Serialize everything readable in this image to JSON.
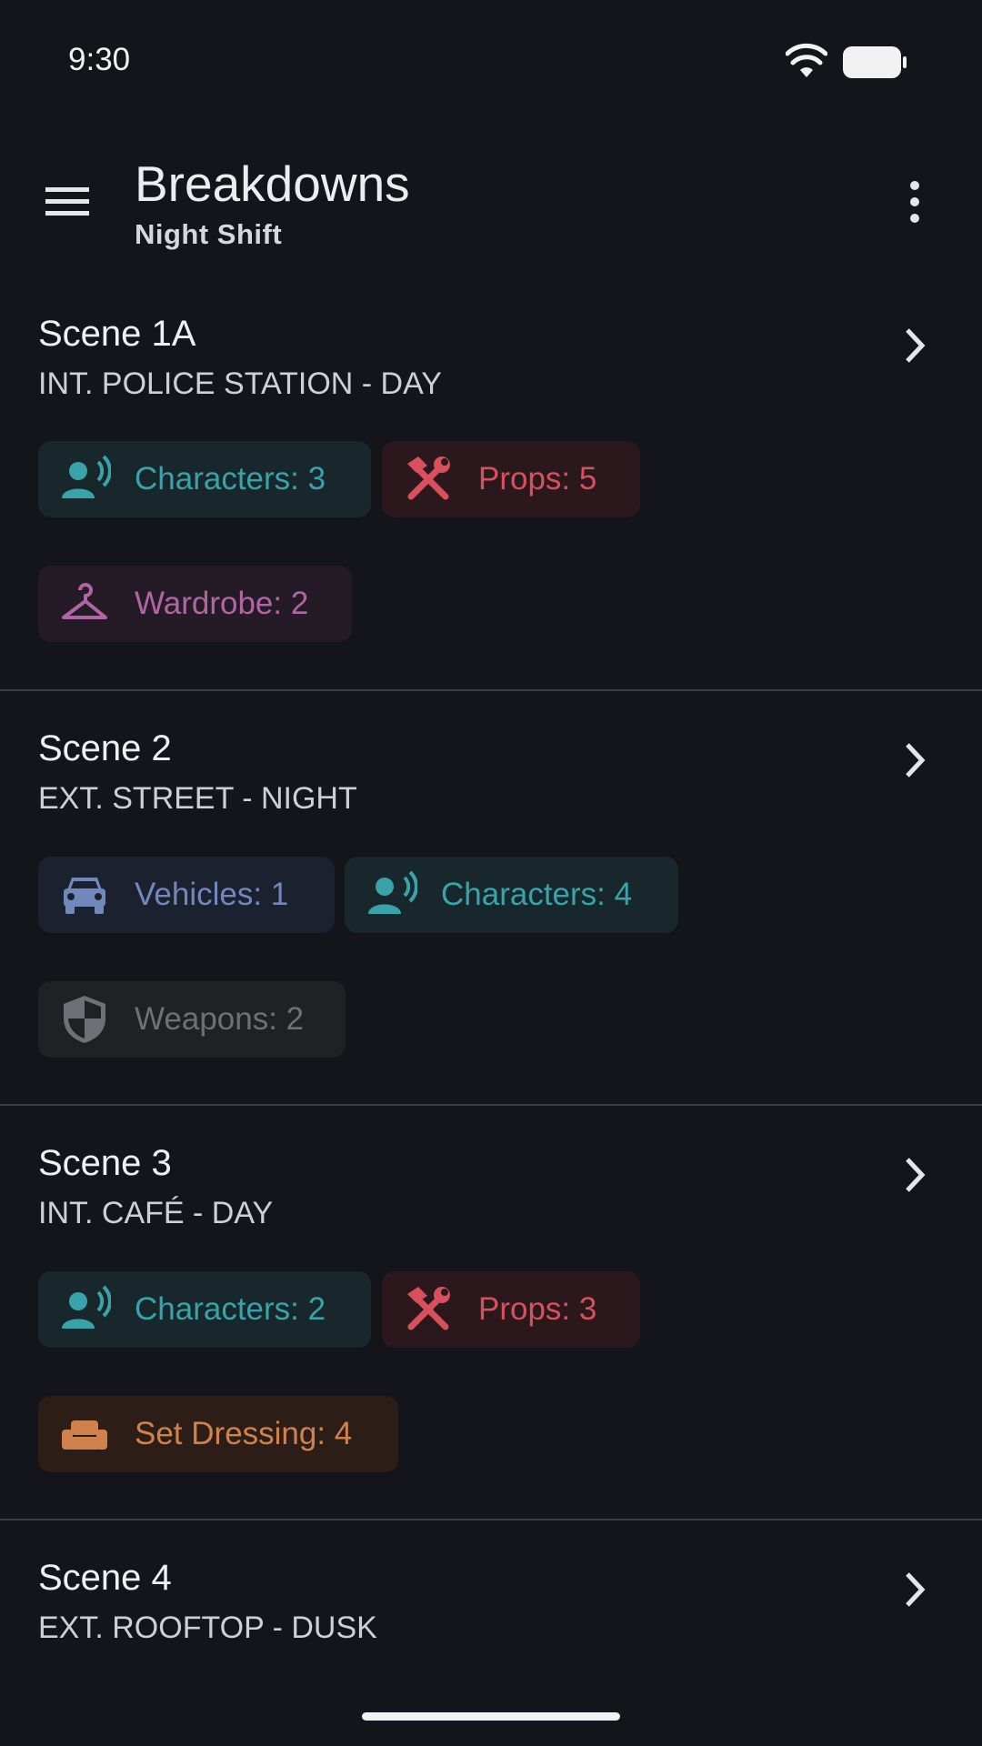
{
  "status": {
    "time": "9:30"
  },
  "app_bar": {
    "title": "Breakdowns",
    "subtitle": "Night Shift"
  },
  "scenes": [
    {
      "title": "Scene 1A",
      "heading": "INT. POLICE STATION - DAY",
      "chips": [
        {
          "label": "Characters: 3",
          "icon": "person-voice-icon"
        },
        {
          "label": "Props: 5",
          "icon": "tools-icon"
        },
        {
          "label": "Wardrobe: 2",
          "icon": "hanger-icon"
        }
      ]
    },
    {
      "title": "Scene 2",
      "heading": "EXT. STREET - NIGHT",
      "chips": [
        {
          "label": "Vehicles: 1",
          "icon": "car-icon"
        },
        {
          "label": "Characters: 4",
          "icon": "person-voice-icon"
        },
        {
          "label": "Weapons: 2",
          "icon": "shield-icon"
        }
      ]
    },
    {
      "title": "Scene 3",
      "heading": "INT. CAFÉ - DAY",
      "chips": [
        {
          "label": "Characters: 2",
          "icon": "person-voice-icon"
        },
        {
          "label": "Props: 3",
          "icon": "tools-icon"
        },
        {
          "label": "Set Dressing: 4",
          "icon": "sofa-icon"
        }
      ]
    },
    {
      "title": "Scene 4",
      "heading": "EXT. ROOFTOP - DUSK"
    }
  ],
  "colors": {
    "background": "#14151b",
    "characters": "#38a3a8",
    "props": "#d8505e",
    "wardrobe": "#b066a4",
    "vehicles": "#7188ba",
    "weapons": "#6f7076",
    "set_dressing": "#cf814e"
  }
}
